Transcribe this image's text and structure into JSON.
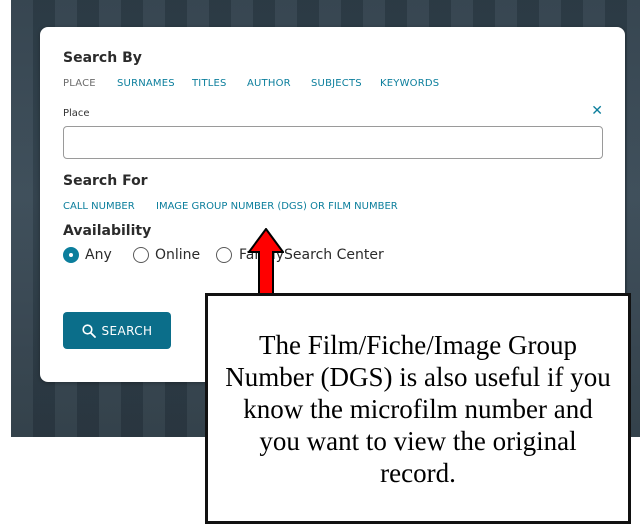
{
  "search_by": {
    "title": "Search By",
    "options": [
      "PLACE",
      "SURNAMES",
      "TITLES",
      "AUTHOR",
      "SUBJECTS",
      "KEYWORDS"
    ]
  },
  "place_field": {
    "label": "Place",
    "value": "",
    "clear_icon": "close-icon"
  },
  "search_for": {
    "title": "Search For",
    "options": [
      "CALL NUMBER",
      "IMAGE GROUP NUMBER (DGS) OR FILM NUMBER"
    ]
  },
  "availability": {
    "title": "Availability",
    "options": [
      "Any",
      "Online",
      "FamilySearch Center"
    ],
    "selected": "Any"
  },
  "search_button": {
    "label": "SEARCH",
    "icon": "search-icon"
  },
  "callout": {
    "text": "The Film/Fiche/Image Group Number (DGS) is also useful if you know the microfilm number and you want to view the original record."
  },
  "colors": {
    "accent": "#0b7e9c",
    "button": "#0b6e8a",
    "arrow_fill": "#ff0000"
  }
}
